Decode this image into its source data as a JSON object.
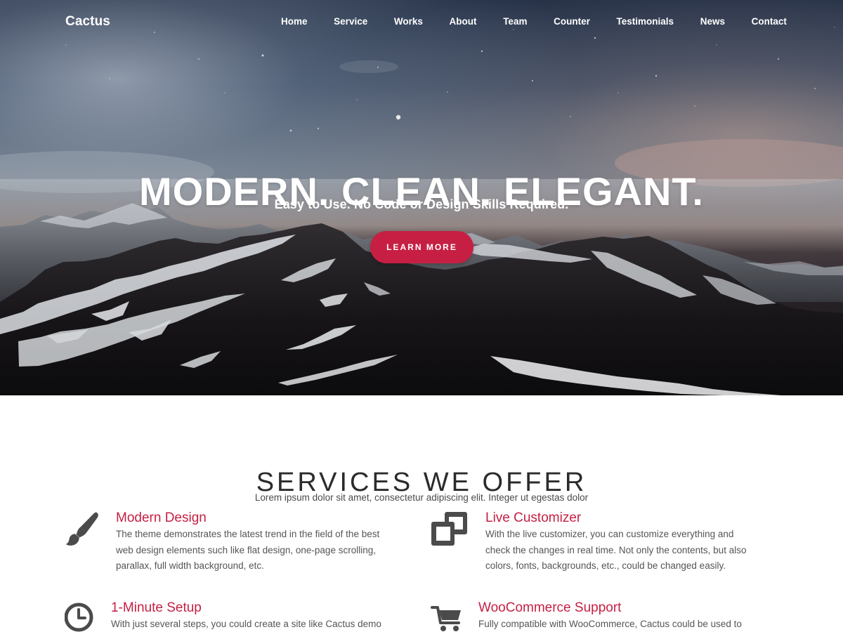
{
  "brand": "Cactus",
  "nav": [
    "Home",
    "Service",
    "Works",
    "About",
    "Team",
    "Counter",
    "Testimonials",
    "News",
    "Contact"
  ],
  "hero": {
    "title": "MODERN. CLEAN. ELEGANT.",
    "subtitle": "Easy to Use. No Code or Design Skills Required.",
    "button": "LEARN MORE"
  },
  "services": {
    "title": "SERVICES WE OFFER",
    "subtitle": "Lorem ipsum dolor sit amet, consectetur adipiscing elit. Integer ut egestas dolor",
    "items": [
      {
        "icon": "paintbrush-icon",
        "title": "Modern Design",
        "lines": [
          "The theme demonstrates the latest trend in the field of the best",
          "web design elements such like flat design, one-page scrolling,",
          "parallax, full width background, etc."
        ]
      },
      {
        "icon": "customize-windows-icon",
        "title": "Live Customizer",
        "lines": [
          "With the live customizer, you can customize everything and",
          "check the changes in real time. Not only the contents, but also",
          "colors, fonts, backgrounds, etc., could be changed easily."
        ]
      },
      {
        "icon": "clock-icon",
        "title": "1-Minute Setup",
        "lines": [
          "With just several steps, you could create a site like Cactus demo"
        ]
      },
      {
        "icon": "shopping-cart-icon",
        "title": "WooCommerce Support",
        "lines": [
          "Fully compatible with WooCommerce, Cactus could be used to"
        ]
      }
    ]
  },
  "colors": {
    "accent": "#c61f43",
    "heading": "#2b2b2b",
    "body_text": "#555555"
  }
}
